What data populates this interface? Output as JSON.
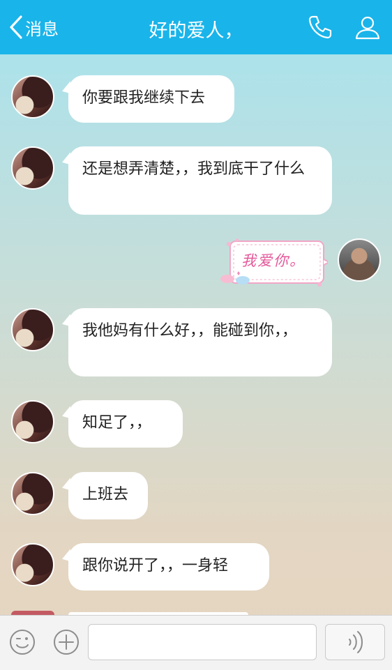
{
  "header": {
    "back_label": "消息",
    "title": "好的爱人，"
  },
  "messages": [
    {
      "text": "你要跟我继续下去"
    },
    {
      "text": "还是想弄清楚，，我到底干了什么"
    },
    {
      "sticker_text": "我爱你。"
    },
    {
      "text": "我他妈有什么好，，能碰到你，，"
    },
    {
      "text": "知足了，，"
    },
    {
      "text": "上班去"
    },
    {
      "text": "跟你说开了，，一身轻"
    }
  ],
  "icons": {
    "back": "chevron-left-icon",
    "call": "phone-icon",
    "profile": "person-icon",
    "emoji": "smiley-icon",
    "plus": "plus-circle-icon",
    "voice": "voice-wave-icon"
  },
  "colors": {
    "header": "#19b4ea",
    "bubble": "#ffffff",
    "sticker_text": "#e4589a"
  },
  "input": {
    "value": ""
  }
}
